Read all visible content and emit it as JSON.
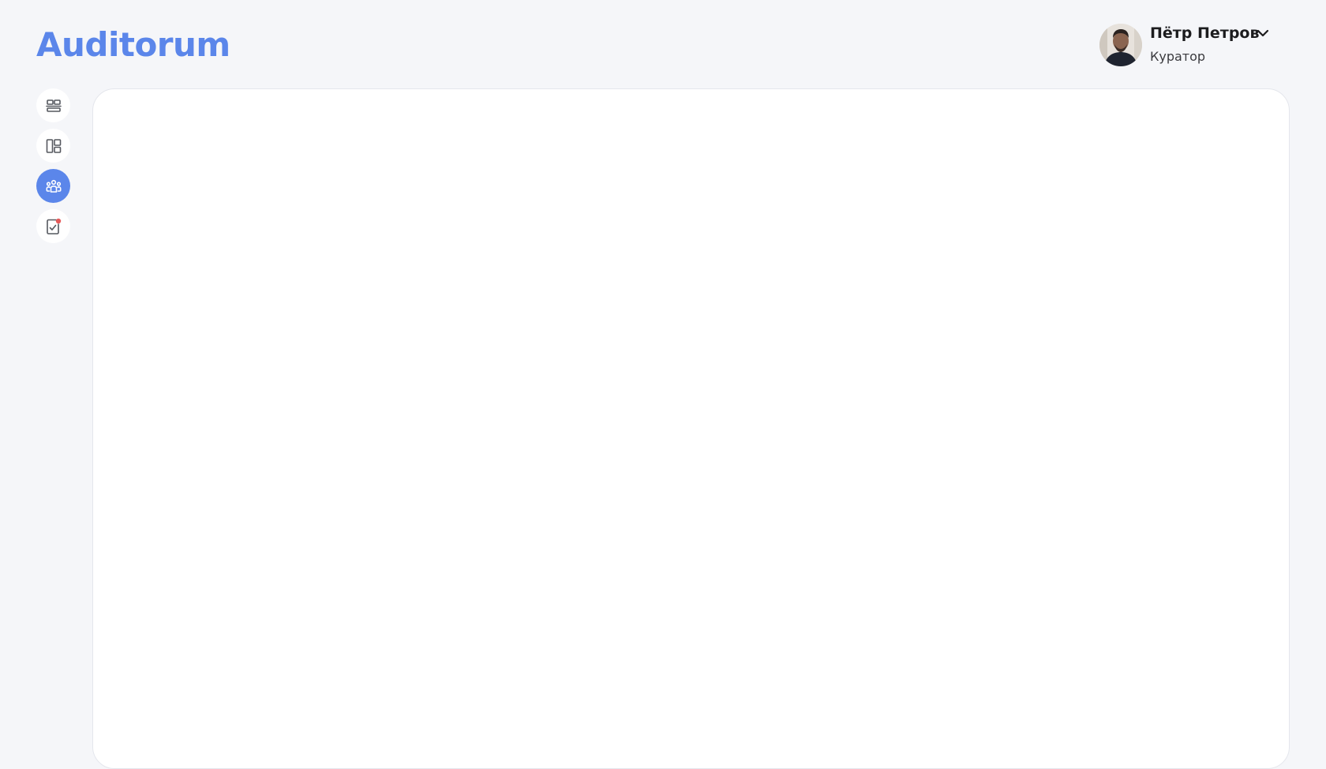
{
  "app": {
    "title": "Auditorum"
  },
  "colors": {
    "accent": "#5b86ea",
    "background": "#f5f6f9",
    "panel": "#ffffff",
    "notification": "#e65a5a"
  },
  "user": {
    "name": "Пётр Петров",
    "role": "Куратор",
    "avatar_icon": "user-avatar-photo",
    "menu_icon": "chevron-down-icon"
  },
  "sidebar": {
    "items": [
      {
        "icon": "layers-icon",
        "active": false
      },
      {
        "icon": "dashboard-layout-icon",
        "active": false
      },
      {
        "icon": "users-group-icon",
        "active": true
      },
      {
        "icon": "tasks-checklist-icon",
        "active": false,
        "badge": true
      }
    ]
  }
}
